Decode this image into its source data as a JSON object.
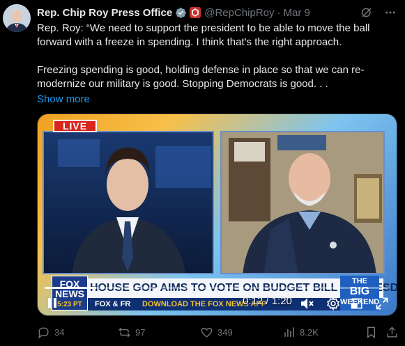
{
  "post": {
    "author_name": "Rep. Chip Roy Press Office",
    "handle": "@RepChipRoy",
    "separator": "·",
    "date": "Mar 9",
    "paragraph1": "Rep. Roy: “We need to support the president to be able to move the ball forward with a freeze in spending. I think that's the right approach.",
    "paragraph2": "Freezing spending is good, holding defense in place so that we can re-modernize our military is good. Stopping Democrats is good. . .",
    "show_more": "Show more"
  },
  "video": {
    "live_label": "LIVE",
    "headline": "HOUSE GOP AIMS TO VOTE ON BUDGET BILL ON TUESDAY",
    "network": "FOX NEWS",
    "network_time": "5:23 PT",
    "ticker_brand": "FOX & FR",
    "ticker_text": "DOWNLOAD THE FOX NEWS APP",
    "show_logo_top": "THE",
    "show_logo_big": "BIG",
    "show_logo_bottom": "WEEKEND",
    "time_display": "0:12 / 1:20",
    "progress": 0.15
  },
  "actions": {
    "replies": "34",
    "reposts": "97",
    "likes": "349",
    "views": "8.2K"
  },
  "colors": {
    "accent": "#1d9bf0",
    "verified": "#829aab",
    "muted": "#71767b",
    "repost_green": "#00ba7c"
  },
  "icons": [
    "grok-icon",
    "more-icon",
    "verified-icon",
    "affiliate-icon",
    "play-pause-icon",
    "volume-icon",
    "settings-icon",
    "pip-icon",
    "fullscreen-icon",
    "reply-icon",
    "repost-icon",
    "like-icon",
    "views-icon",
    "bookmark-icon",
    "share-icon"
  ]
}
